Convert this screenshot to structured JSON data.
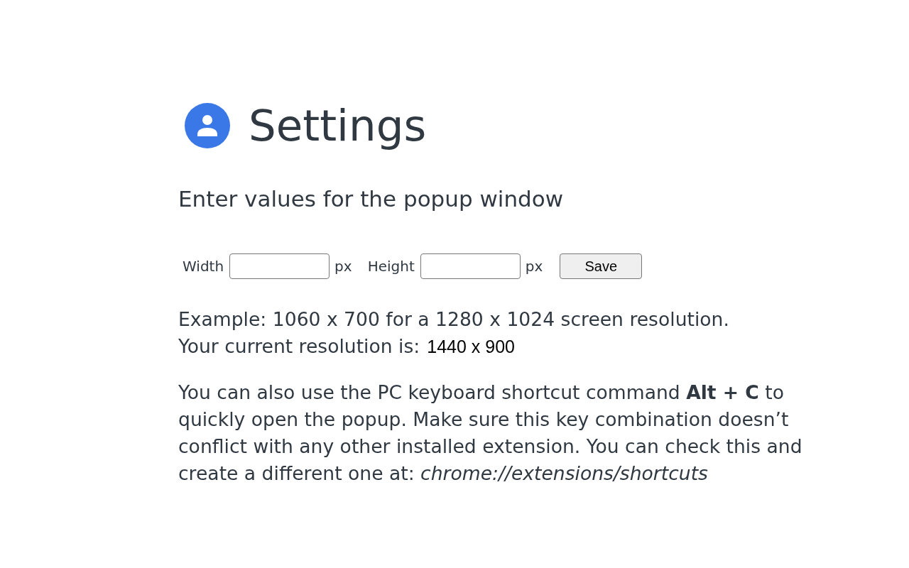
{
  "header": {
    "title": "Settings"
  },
  "subtitle": "Enter values for the popup window",
  "form": {
    "fields": [
      {
        "label": "Width",
        "unit": "px"
      },
      {
        "label": "Height",
        "unit": "px"
      }
    ],
    "save_button": "Save"
  },
  "example": "Example: 1060 x 700 for a 1280 x 1024 screen resolution.",
  "current_resolution": {
    "label": "Your current resolution is:",
    "value": "1440 x 900"
  },
  "shortcut_note": "You can also use the PC keyboard shortcut command **Alt + C** to quickly open the popup. Make sure this key combination doesn’t conflict with any other installed extension. You can check this and create a different one at: *chrome://extensions/shortcuts*"
}
